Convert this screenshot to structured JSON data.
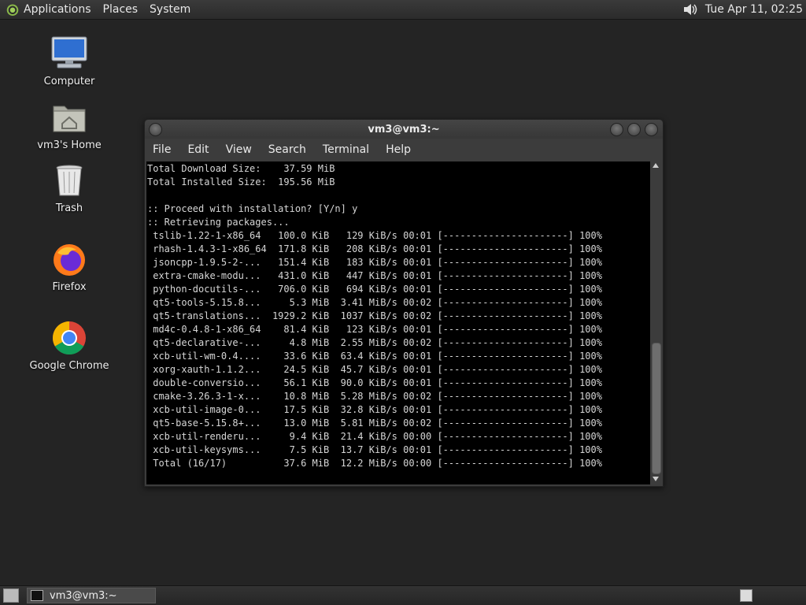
{
  "top_panel": {
    "menus": [
      "Applications",
      "Places",
      "System"
    ],
    "clock": "Tue Apr 11, 02:25",
    "icons": {
      "logo": "gnome-foot-icon",
      "volume": "volume-icon"
    }
  },
  "desktop_icons": [
    {
      "label": "Computer",
      "icon": "computer-icon"
    },
    {
      "label": "vm3's Home",
      "icon": "home-folder-icon"
    },
    {
      "label": "Trash",
      "icon": "trash-icon"
    },
    {
      "label": "Firefox",
      "icon": "firefox-icon"
    },
    {
      "label": "Google Chrome",
      "icon": "chrome-icon"
    }
  ],
  "window": {
    "title": "vm3@vm3:~",
    "menus": [
      "File",
      "Edit",
      "View",
      "Search",
      "Terminal",
      "Help"
    ],
    "terminal_lines": [
      "Total Download Size:    37.59 MiB",
      "Total Installed Size:  195.56 MiB",
      "",
      ":: Proceed with installation? [Y/n] y",
      ":: Retrieving packages...",
      " tslib-1.22-1-x86_64   100.0 KiB   129 KiB/s 00:01 [----------------------] 100%",
      " rhash-1.4.3-1-x86_64  171.8 KiB   208 KiB/s 00:01 [----------------------] 100%",
      " jsoncpp-1.9.5-2-...   151.4 KiB   183 KiB/s 00:01 [----------------------] 100%",
      " extra-cmake-modu...   431.0 KiB   447 KiB/s 00:01 [----------------------] 100%",
      " python-docutils-...   706.0 KiB   694 KiB/s 00:01 [----------------------] 100%",
      " qt5-tools-5.15.8...     5.3 MiB  3.41 MiB/s 00:02 [----------------------] 100%",
      " qt5-translations...  1929.2 KiB  1037 KiB/s 00:02 [----------------------] 100%",
      " md4c-0.4.8-1-x86_64    81.4 KiB   123 KiB/s 00:01 [----------------------] 100%",
      " qt5-declarative-...     4.8 MiB  2.55 MiB/s 00:02 [----------------------] 100%",
      " xcb-util-wm-0.4....    33.6 KiB  63.4 KiB/s 00:01 [----------------------] 100%",
      " xorg-xauth-1.1.2...    24.5 KiB  45.7 KiB/s 00:01 [----------------------] 100%",
      " double-conversio...    56.1 KiB  90.0 KiB/s 00:01 [----------------------] 100%",
      " cmake-3.26.3-1-x...    10.8 MiB  5.28 MiB/s 00:02 [----------------------] 100%",
      " xcb-util-image-0...    17.5 KiB  32.8 KiB/s 00:01 [----------------------] 100%",
      " qt5-base-5.15.8+...    13.0 MiB  5.81 MiB/s 00:02 [----------------------] 100%",
      " xcb-util-renderu...     9.4 KiB  21.4 KiB/s 00:00 [----------------------] 100%",
      " xcb-util-keysyms...     7.5 KiB  13.7 KiB/s 00:01 [----------------------] 100%",
      " Total (16/17)          37.6 MiB  12.2 MiB/s 00:00 [----------------------] 100%"
    ]
  },
  "taskbar": {
    "task_label": "vm3@vm3:~"
  }
}
